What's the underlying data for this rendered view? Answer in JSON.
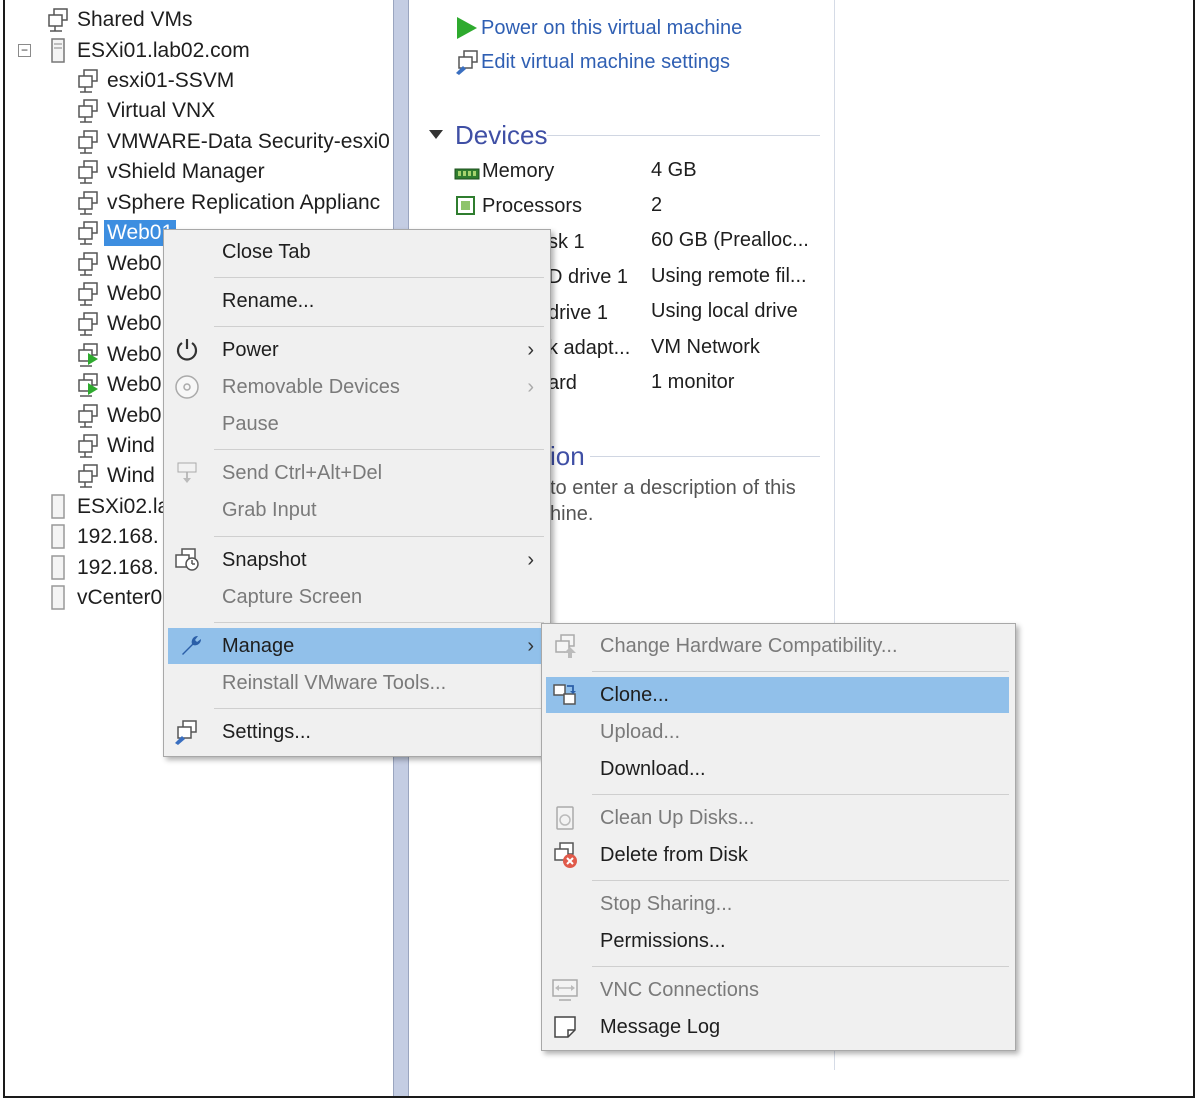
{
  "tree": {
    "shared_vms": "Shared VMs",
    "host1": "ESXi01.lab02.com",
    "vms": [
      "esxi01-SSVM",
      "Virtual VNX",
      "VMWARE-Data Security-esxi0",
      "vShield Manager",
      "vSphere Replication Applianc",
      "Web01",
      "Web0",
      "Web0",
      "Web0",
      "Web0",
      "Web0",
      "Web0",
      "Wind",
      "Wind"
    ],
    "hosts": [
      "ESXi02.la",
      "192.168.",
      "192.168.",
      "vCenter0"
    ],
    "expander_symbol": "−"
  },
  "right": {
    "power_on": "Power on this virtual machine",
    "edit_settings": "Edit virtual machine settings",
    "devices_title": "Devices",
    "devices": [
      {
        "name": "Memory",
        "value": "4 GB"
      },
      {
        "name": "Processors",
        "value": "2"
      },
      {
        "name": "sk 1",
        "value": "60 GB (Prealloc..."
      },
      {
        "name": "D drive 1",
        "value": "Using remote fil..."
      },
      {
        "name": "drive 1",
        "value": "Using local drive"
      },
      {
        "name": "k adapt...",
        "value": "VM Network"
      },
      {
        "name": "ard",
        "value": "1 monitor"
      }
    ],
    "description_title": "ion",
    "description_lines": [
      "to enter a description of this",
      "hine."
    ]
  },
  "context_menu": {
    "close_tab": "Close Tab",
    "rename": "Rename...",
    "power": "Power",
    "removable_devices": "Removable Devices",
    "pause": "Pause",
    "send_cad": "Send Ctrl+Alt+Del",
    "grab_input": "Grab Input",
    "snapshot": "Snapshot",
    "capture_screen": "Capture Screen",
    "manage": "Manage",
    "reinstall_tools": "Reinstall VMware Tools...",
    "settings": "Settings...",
    "submenu_arrow": "›"
  },
  "manage_menu": {
    "change_hw": "Change Hardware Compatibility...",
    "clone": "Clone...",
    "upload": "Upload...",
    "download": "Download...",
    "clean_up": "Clean Up Disks...",
    "delete_disk": "Delete from Disk",
    "stop_sharing": "Stop Sharing...",
    "permissions": "Permissions...",
    "vnc": "VNC Connections",
    "message_log": "Message Log"
  },
  "colors": {
    "selection": "#3d8ee0",
    "menu_highlight": "#91c0ea",
    "link": "#2f5fb3",
    "section_title": "#3f4fa5",
    "splitter": "#c4cde3"
  }
}
